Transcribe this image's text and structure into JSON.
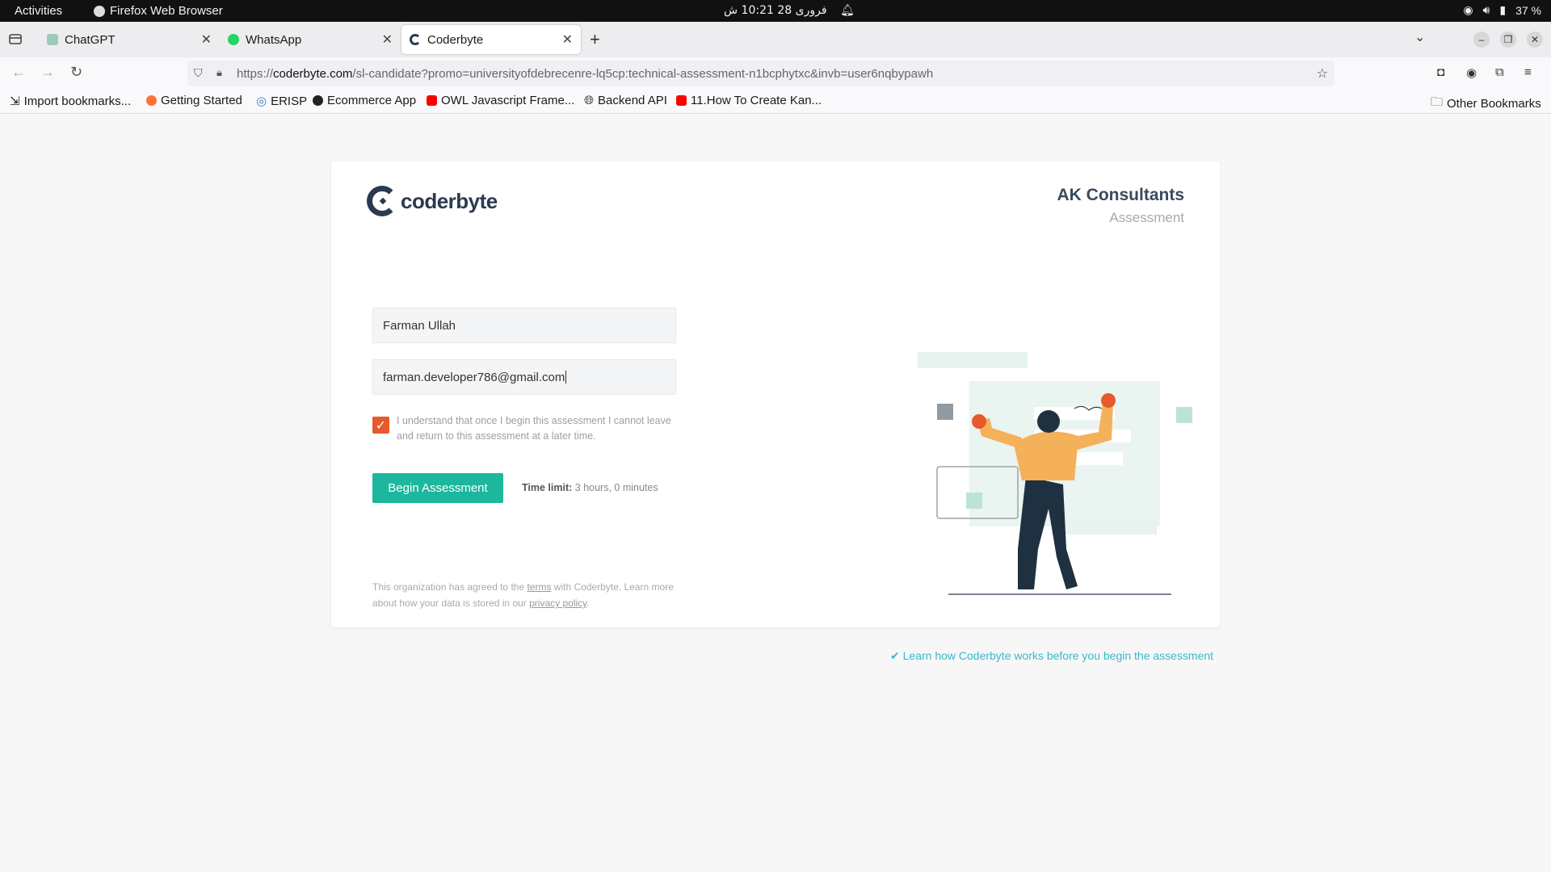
{
  "system_bar": {
    "activities": "Activities",
    "app_name": "Firefox Web Browser",
    "clock": "فروری 28  10:21 ش",
    "battery": "37 %"
  },
  "tabs": [
    {
      "title": "ChatGPT",
      "icon": "chatgpt-icon",
      "active": false
    },
    {
      "title": "WhatsApp",
      "icon": "whatsapp-icon",
      "active": false
    },
    {
      "title": "Coderbyte",
      "icon": "coderbyte-icon",
      "active": true
    }
  ],
  "address_bar": {
    "url_scheme": "https://",
    "url_host": "coderbyte.com",
    "url_path": "/sl-candidate?promo=universityofdebrecenre-lq5cp:technical-assessment-n1bcphytxc&invb=user6nqbypawh"
  },
  "bookmarks": [
    {
      "label": "Import bookmarks...",
      "icon": "import-icon"
    },
    {
      "label": "Getting Started",
      "icon": "firefox-icon"
    },
    {
      "label": "ERISP",
      "icon": "fingerprint-icon"
    },
    {
      "label": "Ecommerce App",
      "icon": "app-icon"
    },
    {
      "label": "OWL Javascript Frame...",
      "icon": "youtube-icon"
    },
    {
      "label": "Backend API",
      "icon": "globe-icon"
    },
    {
      "label": "11.How To Create Kan...",
      "icon": "youtube-icon"
    }
  ],
  "other_bookmarks": "Other Bookmarks",
  "page": {
    "logo_text": "coderbyte",
    "company_name": "AK Consultants",
    "company_subtitle": "Assessment",
    "name_value": "Farman Ullah",
    "email_value": "farman.developer786@gmail.com",
    "consent_text": "I understand that once I begin this assessment I cannot leave and return to this assessment at a later time.",
    "consent_checked": true,
    "begin_button": "Begin Assessment",
    "time_limit_label": "Time limit:",
    "time_limit_value": "3 hours, 0 minutes",
    "footnote_1": "This organization has agreed to the ",
    "footnote_terms": "terms",
    "footnote_2": " with Coderbyte. Learn more about how your data is stored in our ",
    "footnote_privacy": "privacy policy",
    "footnote_3": ".",
    "learn_link": "✔ Learn how Coderbyte works before you begin the assessment"
  },
  "colors": {
    "accent_green": "#1cb79d",
    "checkbox_orange": "#e8592b",
    "brand_navy": "#2b3a4f",
    "link_teal": "#3bb8c9"
  }
}
